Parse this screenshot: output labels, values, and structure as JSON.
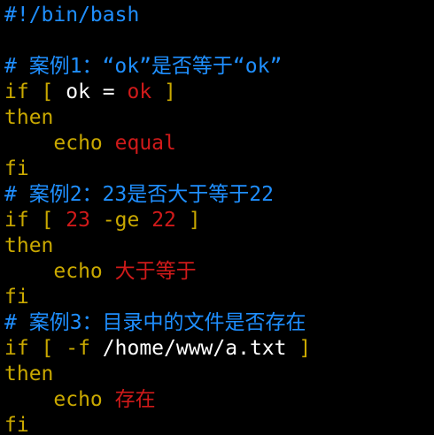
{
  "colors": {
    "background": "#000000",
    "comment": "#1f8fff",
    "keyword": "#c9a800",
    "string": "#d01a1a",
    "plain": "#ffffff"
  },
  "lines": [
    [
      {
        "t": "comment",
        "v": "#!/bin/bash"
      }
    ],
    [],
    [
      {
        "t": "comment",
        "v": "# 案例1：“ok”是否等于“ok”"
      }
    ],
    [
      {
        "t": "kw",
        "v": "if [ "
      },
      {
        "t": "plain",
        "v": "ok = "
      },
      {
        "t": "str",
        "v": "ok"
      },
      {
        "t": "kw",
        "v": " ]"
      }
    ],
    [
      {
        "t": "kw",
        "v": "then"
      }
    ],
    [
      {
        "t": "plain",
        "v": "    "
      },
      {
        "t": "cmd",
        "v": "echo"
      },
      {
        "t": "plain",
        "v": " "
      },
      {
        "t": "str",
        "v": "equal"
      }
    ],
    [
      {
        "t": "kw",
        "v": "fi"
      }
    ],
    [
      {
        "t": "comment",
        "v": "# 案例2：23是否大于等于22"
      }
    ],
    [
      {
        "t": "kw",
        "v": "if [ "
      },
      {
        "t": "str",
        "v": "23"
      },
      {
        "t": "kw",
        "v": " -ge "
      },
      {
        "t": "str",
        "v": "22"
      },
      {
        "t": "kw",
        "v": " ]"
      }
    ],
    [
      {
        "t": "kw",
        "v": "then"
      }
    ],
    [
      {
        "t": "plain",
        "v": "    "
      },
      {
        "t": "cmd",
        "v": "echo"
      },
      {
        "t": "plain",
        "v": " "
      },
      {
        "t": "str",
        "v": "大于等于"
      }
    ],
    [
      {
        "t": "kw",
        "v": "fi"
      }
    ],
    [
      {
        "t": "comment",
        "v": "# 案例3：目录中的文件是否存在"
      }
    ],
    [
      {
        "t": "kw",
        "v": "if [ -f "
      },
      {
        "t": "plain",
        "v": "/home/www/a.txt"
      },
      {
        "t": "kw",
        "v": " ]"
      }
    ],
    [
      {
        "t": "kw",
        "v": "then"
      }
    ],
    [
      {
        "t": "plain",
        "v": "    "
      },
      {
        "t": "cmd",
        "v": "echo"
      },
      {
        "t": "plain",
        "v": " "
      },
      {
        "t": "str",
        "v": "存在"
      }
    ],
    [
      {
        "t": "kw",
        "v": "fi"
      }
    ]
  ]
}
